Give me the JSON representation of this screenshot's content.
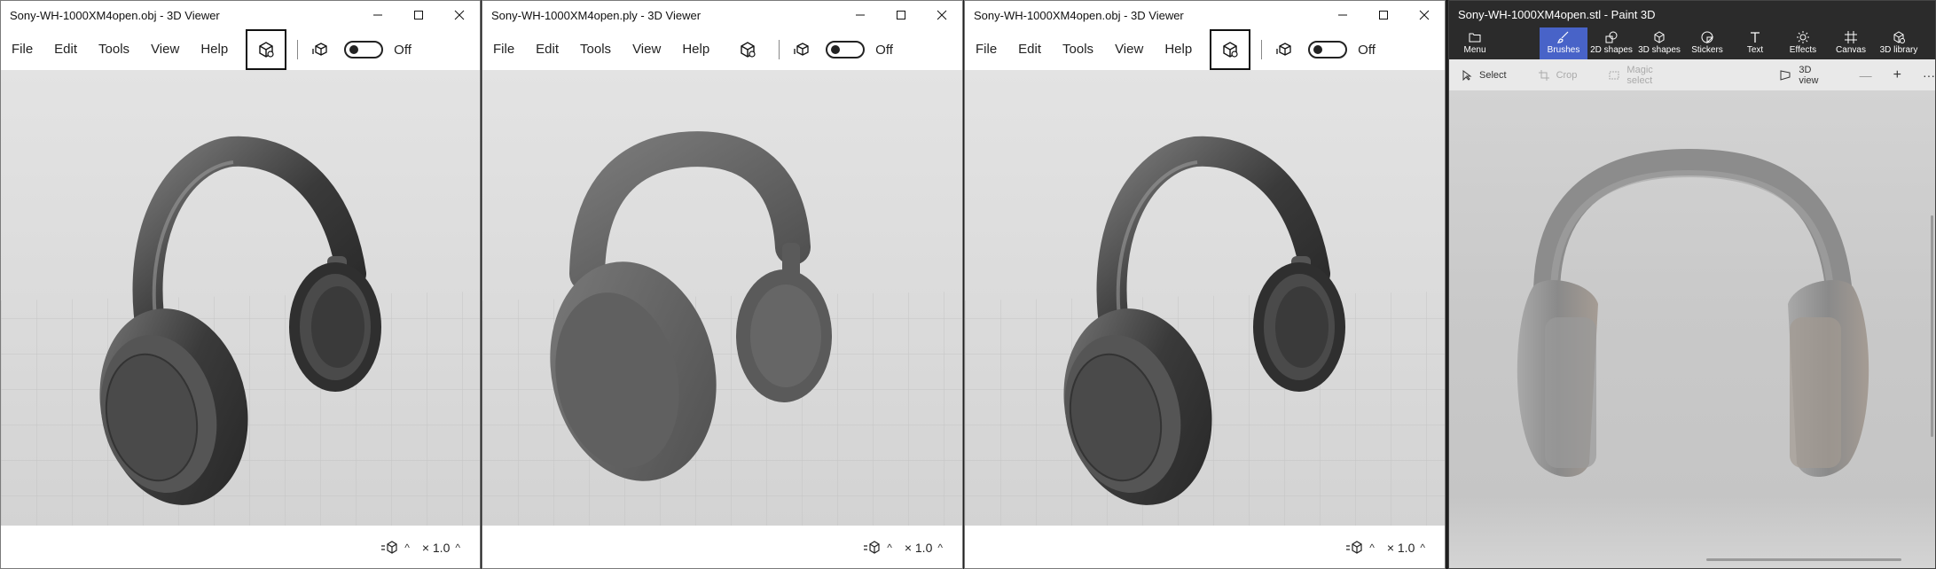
{
  "windows": [
    {
      "title": "Sony-WH-1000XM4open.obj - 3D Viewer",
      "menu": [
        "File",
        "Edit",
        "Tools",
        "View",
        "Help"
      ],
      "toggle_label": "Off",
      "zoom_label": "× 1.0"
    },
    {
      "title": "Sony-WH-1000XM4open.ply - 3D Viewer",
      "menu": [
        "File",
        "Edit",
        "Tools",
        "View",
        "Help"
      ],
      "toggle_label": "Off",
      "zoom_label": "× 1.0"
    },
    {
      "title": "Sony-WH-1000XM4open.obj - 3D Viewer",
      "menu": [
        "File",
        "Edit",
        "Tools",
        "View",
        "Help"
      ],
      "toggle_label": "Off",
      "zoom_label": "× 1.0"
    }
  ],
  "paint3d": {
    "title": "Sony-WH-1000XM4open.stl - Paint 3D",
    "ribbon": [
      {
        "label": "Menu",
        "icon": "folder-icon"
      },
      {
        "label": "Brushes",
        "icon": "brush-icon"
      },
      {
        "label": "2D shapes",
        "icon": "2d-shapes-icon"
      },
      {
        "label": "3D shapes",
        "icon": "3d-shapes-icon"
      },
      {
        "label": "Stickers",
        "icon": "stickers-icon"
      },
      {
        "label": "Text",
        "icon": "text-icon"
      },
      {
        "label": "Effects",
        "icon": "effects-icon"
      },
      {
        "label": "Canvas",
        "icon": "canvas-icon"
      },
      {
        "label": "3D library",
        "icon": "3d-library-icon"
      }
    ],
    "active_tool": "Brushes",
    "toolbar": {
      "select": "Select",
      "crop": "Crop",
      "magic_select": "Magic select",
      "view_3d": "3D view"
    }
  },
  "colors": {
    "paint3d_chrome": "#2b2b2b",
    "paint3d_accent": "#4863c8",
    "viewer_model_obj": "#4a4a4a",
    "viewer_model_ply": "#5c5c5c",
    "paint3d_model": "#8f8f8f"
  }
}
